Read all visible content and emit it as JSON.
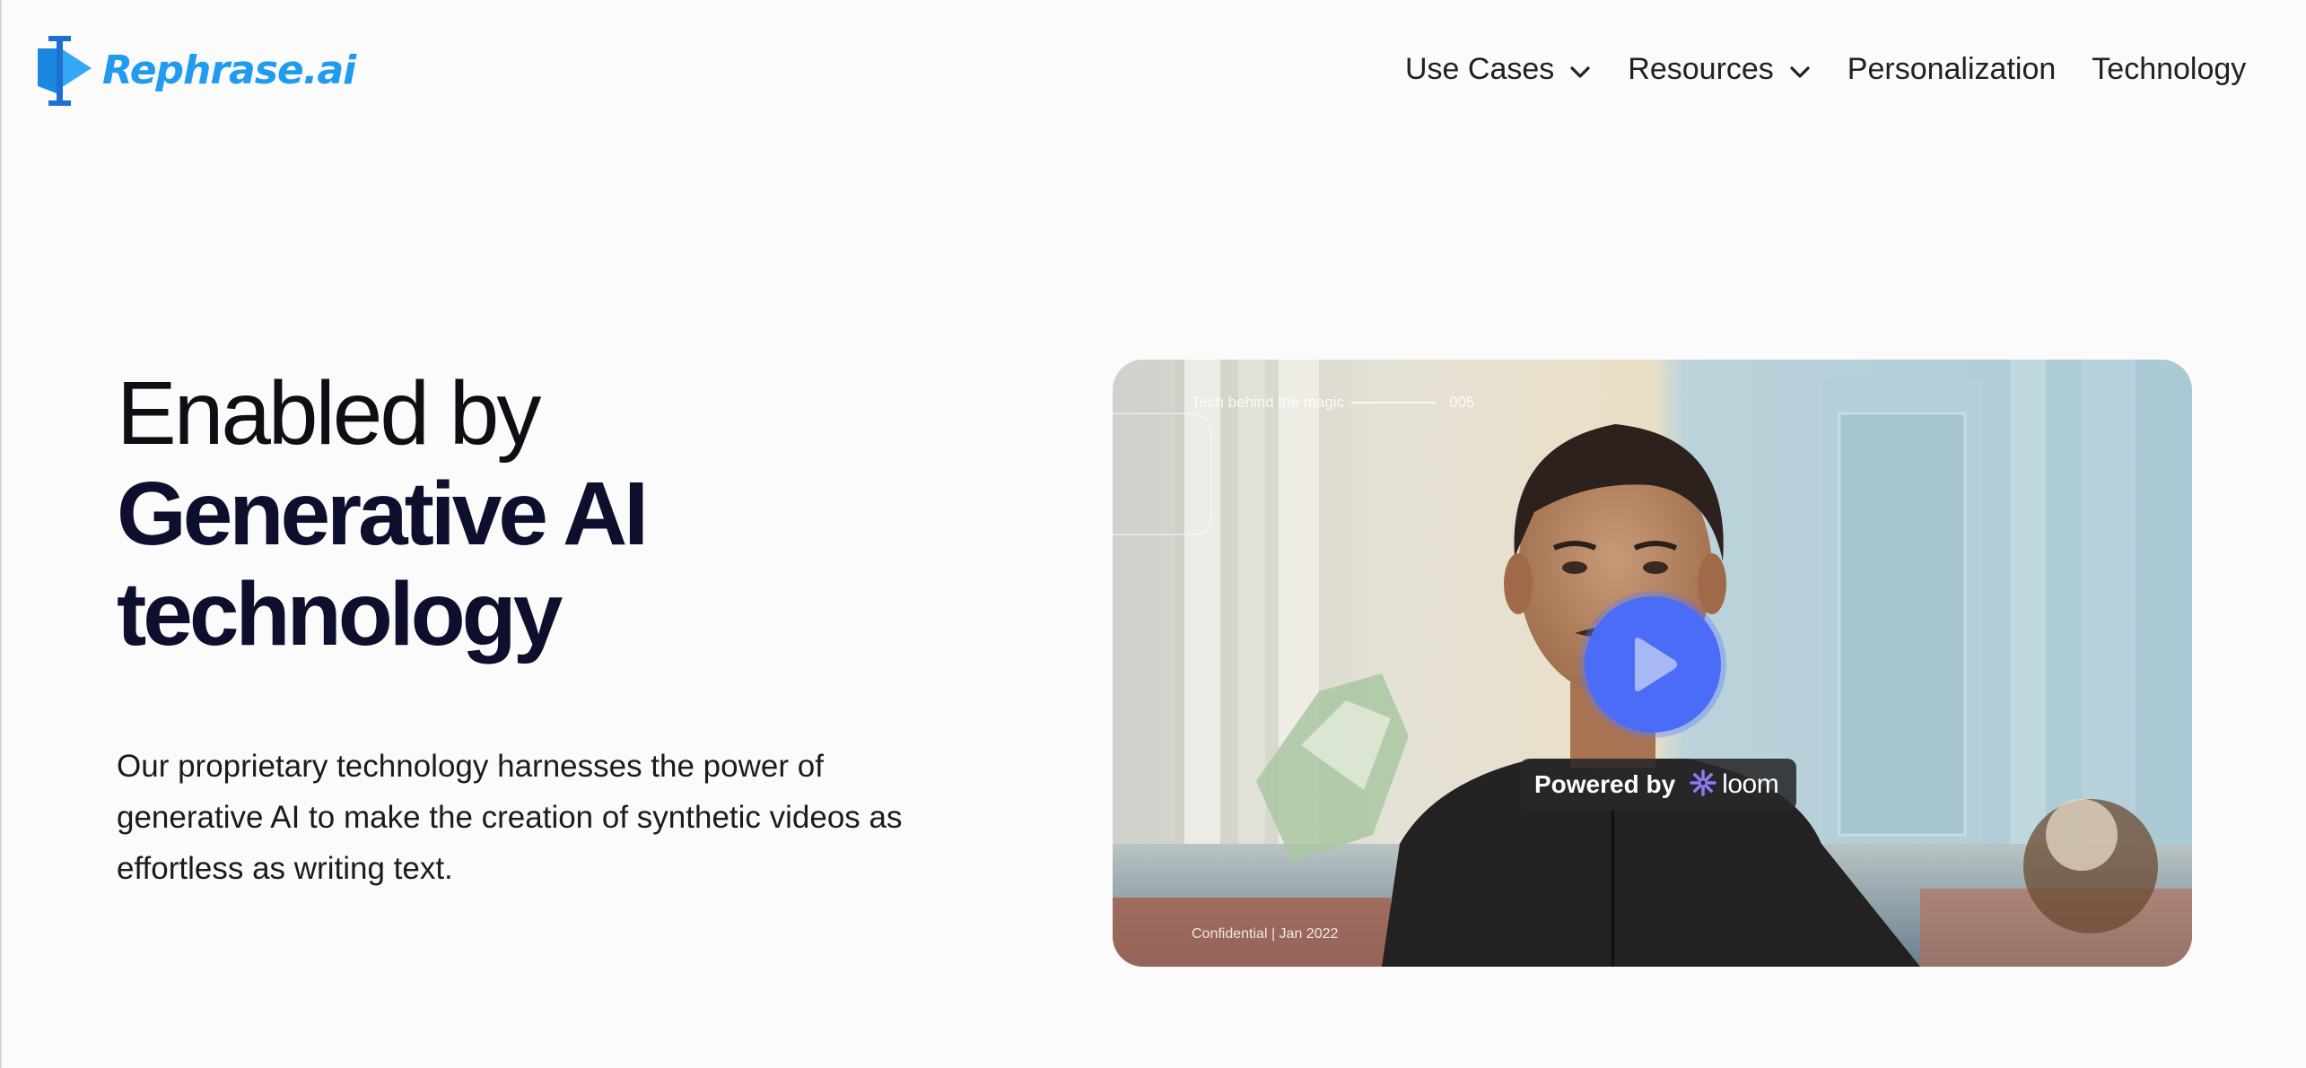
{
  "brand": {
    "name": "Rephrase.ai",
    "color": "#1f9bf0"
  },
  "nav": {
    "items": [
      {
        "label": "Use Cases",
        "has_dropdown": true
      },
      {
        "label": "Resources",
        "has_dropdown": true
      },
      {
        "label": "Personalization",
        "has_dropdown": false
      },
      {
        "label": "Technology",
        "has_dropdown": false
      }
    ]
  },
  "hero": {
    "title_line1": "Enabled by",
    "title_line2": "Generative AI",
    "title_line3": "technology",
    "body": "Our proprietary technology harnesses the power of generative AI to make the creation of synthetic videos as effortless as writing text."
  },
  "video": {
    "caption_top": "Tech behind the magic",
    "caption_number": "005",
    "caption_bottom": "Confidential | Jan 2022",
    "powered_by_label": "Powered by",
    "provider": "loom",
    "play_color": "#4a6cf7",
    "play_icon": "play-icon",
    "provider_icon": "loom-icon"
  }
}
